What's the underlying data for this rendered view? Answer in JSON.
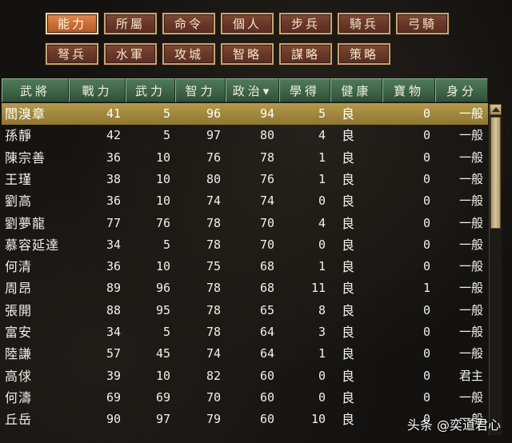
{
  "tabs": [
    {
      "label": "能力",
      "active": true
    },
    {
      "label": "所屬"
    },
    {
      "label": "命令"
    },
    {
      "label": "個人"
    },
    {
      "label": "步兵"
    },
    {
      "label": "騎兵"
    },
    {
      "label": "弓騎"
    },
    {
      "label": "弩兵"
    },
    {
      "label": "水軍"
    },
    {
      "label": "攻城"
    },
    {
      "label": "智略"
    },
    {
      "label": "謀略"
    },
    {
      "label": "策略"
    }
  ],
  "columns": [
    "武將",
    "戰力",
    "武力",
    "智力",
    "政治▾",
    "學得",
    "健康",
    "寶物",
    "身分"
  ],
  "rows": [
    [
      "閻溴章",
      "41",
      "5",
      "96",
      "94",
      "5",
      "良",
      "0",
      "一般"
    ],
    [
      "孫靜",
      "42",
      "5",
      "97",
      "80",
      "4",
      "良",
      "0",
      "一般"
    ],
    [
      "陳宗善",
      "36",
      "10",
      "76",
      "78",
      "1",
      "良",
      "0",
      "一般"
    ],
    [
      "王瑾",
      "38",
      "10",
      "80",
      "76",
      "1",
      "良",
      "0",
      "一般"
    ],
    [
      "劉高",
      "36",
      "10",
      "74",
      "74",
      "0",
      "良",
      "0",
      "一般"
    ],
    [
      "劉夢龍",
      "77",
      "76",
      "78",
      "70",
      "4",
      "良",
      "0",
      "一般"
    ],
    [
      "慕容延達",
      "34",
      "5",
      "78",
      "70",
      "0",
      "良",
      "0",
      "一般"
    ],
    [
      "何清",
      "36",
      "10",
      "75",
      "68",
      "1",
      "良",
      "0",
      "一般"
    ],
    [
      "周昂",
      "89",
      "96",
      "78",
      "68",
      "11",
      "良",
      "1",
      "一般"
    ],
    [
      "張開",
      "88",
      "95",
      "78",
      "65",
      "8",
      "良",
      "0",
      "一般"
    ],
    [
      "富安",
      "34",
      "5",
      "78",
      "64",
      "3",
      "良",
      "0",
      "一般"
    ],
    [
      "陸謙",
      "57",
      "45",
      "74",
      "64",
      "1",
      "良",
      "0",
      "一般"
    ],
    [
      "高俅",
      "39",
      "10",
      "82",
      "60",
      "0",
      "良",
      "0",
      "君主"
    ],
    [
      "何濤",
      "69",
      "69",
      "70",
      "60",
      "0",
      "良",
      "0",
      "一般"
    ],
    [
      "丘岳",
      "90",
      "97",
      "79",
      "60",
      "10",
      "良",
      "0",
      "一般"
    ]
  ],
  "selected_row": 0,
  "watermark": "头条 @奕道君心"
}
